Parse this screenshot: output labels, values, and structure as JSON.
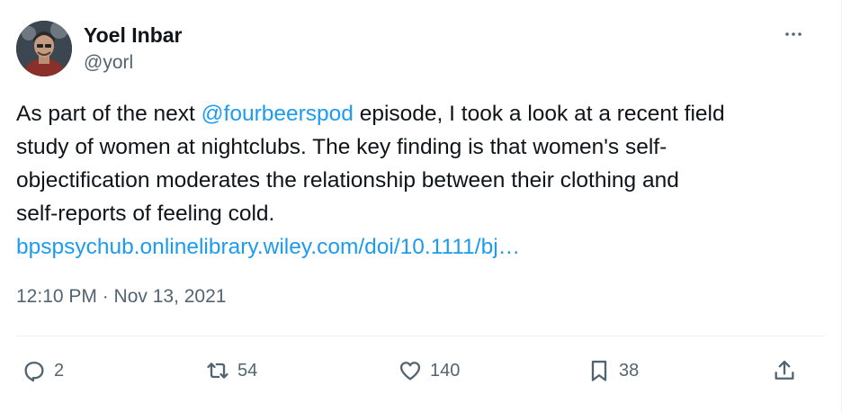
{
  "author": {
    "name": "Yoel Inbar",
    "handle": "@yorl"
  },
  "tweet": {
    "text_parts": {
      "line1_prefix": "As part of the next ",
      "mention": "@fourbeerspod",
      "line1_suffix": " episode, I took a look at a recent field",
      "line2": "study of women at nightclubs. The key finding is that women's self-",
      "line3": "objectification moderates the relationship between their clothing and",
      "line4": "self-reports of feeling cold.",
      "link": "bpspsychub.onlinelibrary.wiley.com/doi/10.1111/bj…"
    },
    "timestamp": "12:10 PM · Nov 13, 2021"
  },
  "actions": {
    "replies": "2",
    "retweets": "54",
    "likes": "140",
    "bookmarks": "38"
  },
  "icons": {
    "more": "more-horizontal-icon",
    "reply": "reply-icon",
    "retweet": "retweet-icon",
    "like": "heart-icon",
    "bookmark": "bookmark-icon",
    "share": "share-icon"
  },
  "colors": {
    "link": "#1d9bf0",
    "secondary_text": "#536471",
    "primary_text": "#0f1419"
  }
}
